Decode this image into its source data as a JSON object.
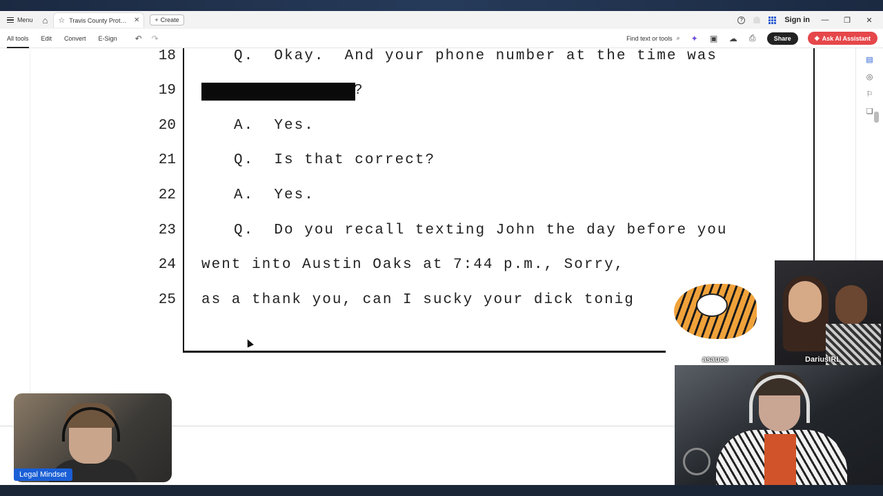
{
  "browser": {
    "menu_label": "Menu",
    "tab_title": "Travis County Protective ...",
    "create_label": "Create",
    "sign_in_label": "Sign in"
  },
  "toolbar": {
    "tabs": [
      "All tools",
      "Edit",
      "Convert",
      "E-Sign"
    ],
    "find_label": "Find text or tools",
    "share_label": "Share",
    "ai_label": "Ask AI Assistant"
  },
  "document": {
    "lines": [
      {
        "num": "18",
        "text": "Q.  Okay.  And your phone number at the time was"
      },
      {
        "num": "19",
        "text": "?"
      },
      {
        "num": "20",
        "text": "A.  Yes."
      },
      {
        "num": "21",
        "text": "Q.  Is that correct?"
      },
      {
        "num": "22",
        "text": "A.  Yes."
      },
      {
        "num": "23",
        "text": "Q.  Do you recall texting John the day before you"
      },
      {
        "num": "24",
        "text": "went into Austin Oaks at 7:44 p.m., Sorry,"
      },
      {
        "num": "25",
        "text": "as a thank you, can I sucky your dick tonig"
      }
    ]
  },
  "streams": {
    "host_name": "Legal Mindset",
    "guest_a": "asauce",
    "guest_b": "DariusIRL"
  },
  "colors": {
    "accent_blue": "#2c5fd3",
    "ai_red": "#e5474a",
    "name_tag_blue": "#1a5fd6"
  }
}
